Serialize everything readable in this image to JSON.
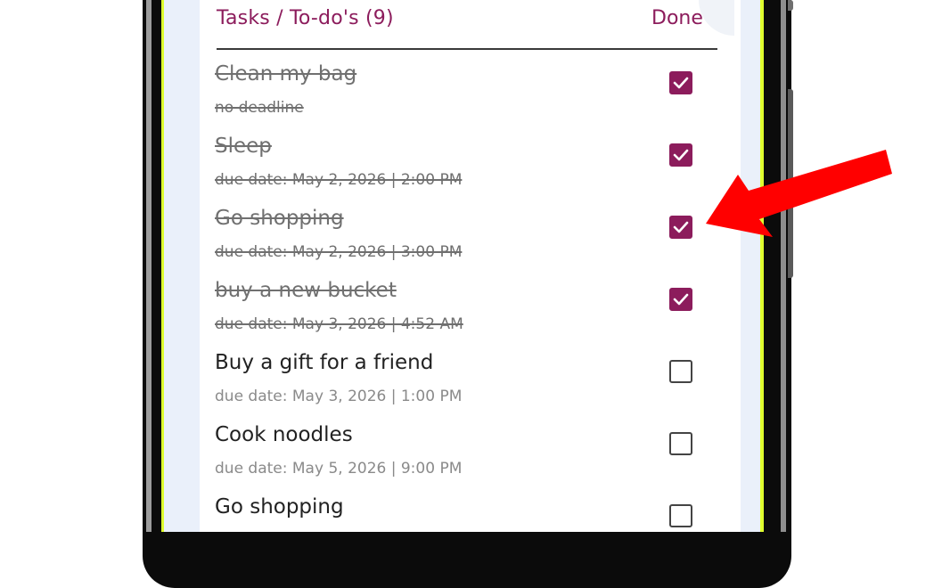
{
  "header": {
    "title": "Tasks / To-do's (9)",
    "done_label": "Done"
  },
  "tasks": [
    {
      "title": "Clean my bag",
      "subtitle": "no deadline",
      "done": true
    },
    {
      "title": "Sleep",
      "subtitle": "due date: May 2, 2026 | 2:00 PM",
      "done": true
    },
    {
      "title": "Go shopping",
      "subtitle": "due date: May 2, 2026 | 3:00 PM",
      "done": true
    },
    {
      "title": "buy a new bucket",
      "subtitle": "due date: May 3, 2026 | 4:52 AM",
      "done": true
    },
    {
      "title": "Buy a gift for a friend",
      "subtitle": "due date: May 3, 2026 | 1:00 PM",
      "done": false
    },
    {
      "title": "Cook noodles",
      "subtitle": "due date: May 5, 2026 | 9:00 PM",
      "done": false
    },
    {
      "title": "Go shopping",
      "subtitle": "",
      "done": false
    }
  ],
  "colors": {
    "accent": "#8c1c5c",
    "arrow": "#ff0000",
    "screen_border": "#dfff2e"
  },
  "icons": {
    "checked": "checkmark-icon",
    "annotation": "red-arrow-icon"
  }
}
